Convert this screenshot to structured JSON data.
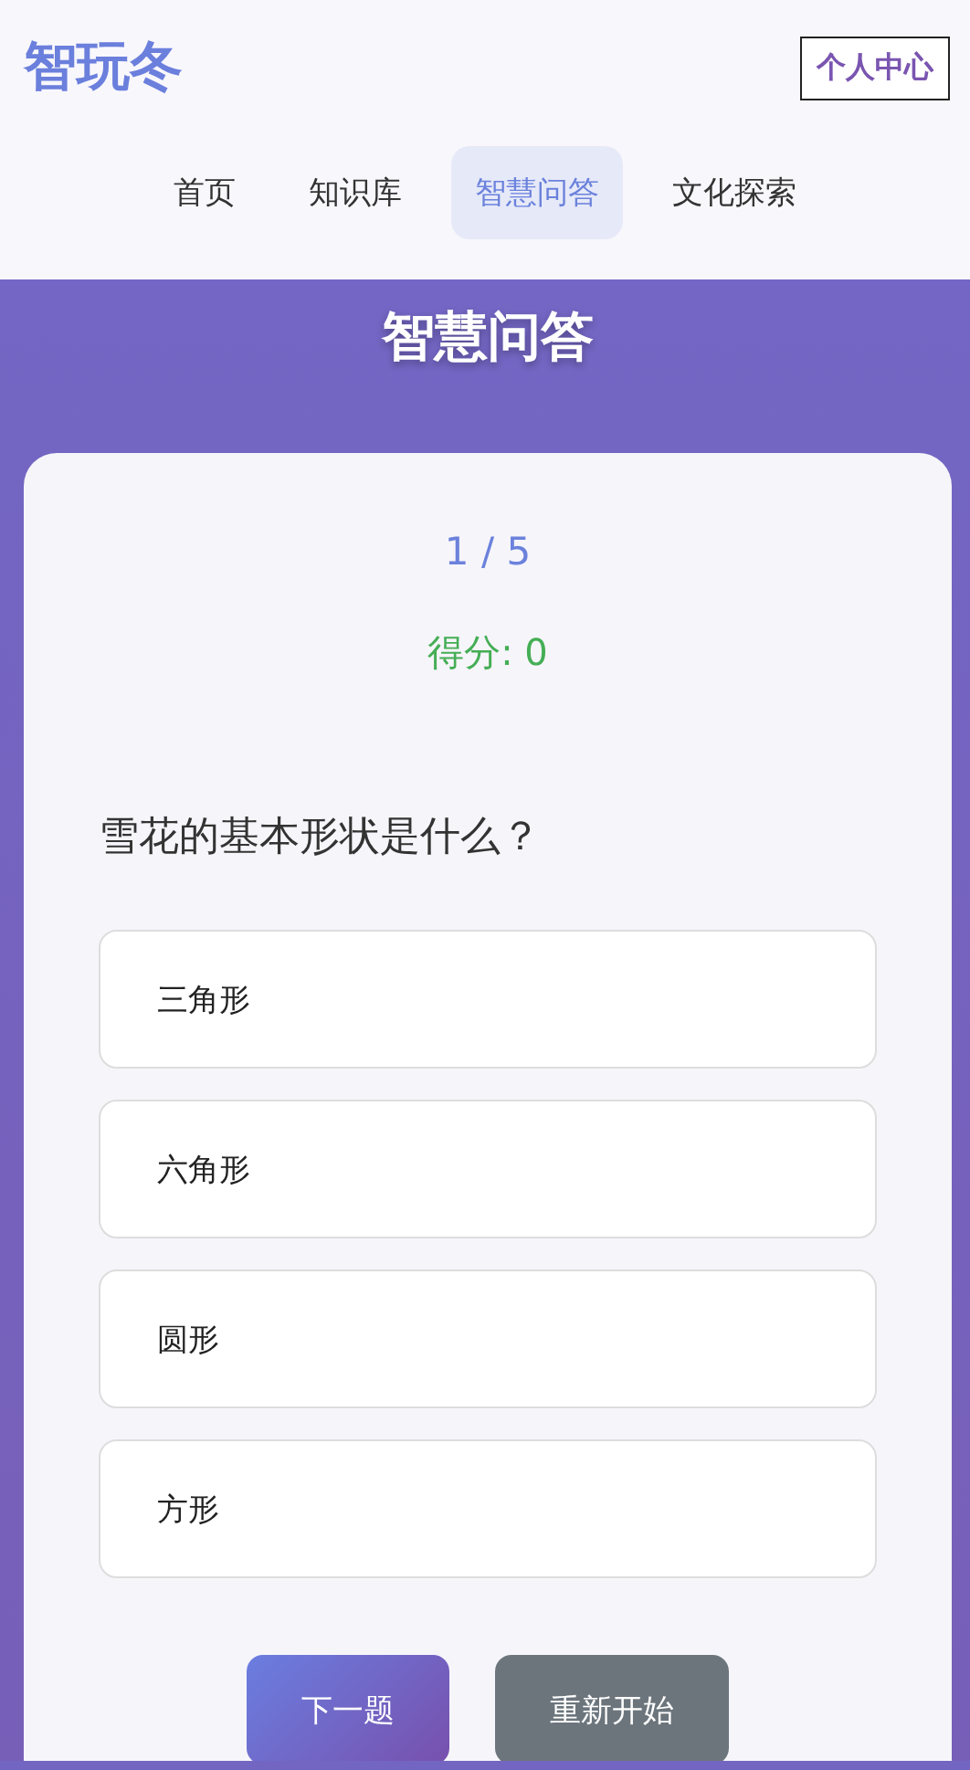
{
  "header": {
    "logo": "智玩冬",
    "profile_button": "个人中心"
  },
  "nav": [
    {
      "label": "首页",
      "selected": false
    },
    {
      "label": "知识库",
      "selected": false
    },
    {
      "label": "智慧问答",
      "selected": true
    },
    {
      "label": "文化探索",
      "selected": false
    }
  ],
  "page_title": "智慧问答",
  "quiz": {
    "progress": "1 / 5",
    "score": "得分: 0",
    "question": "雪花的基本形状是什么？",
    "options": [
      "三角形",
      "六角形",
      "圆形",
      "方形"
    ],
    "buttons": [
      {
        "label": "下一题",
        "kind": "primary"
      },
      {
        "label": "重新开始",
        "kind": "secondary"
      }
    ]
  }
}
